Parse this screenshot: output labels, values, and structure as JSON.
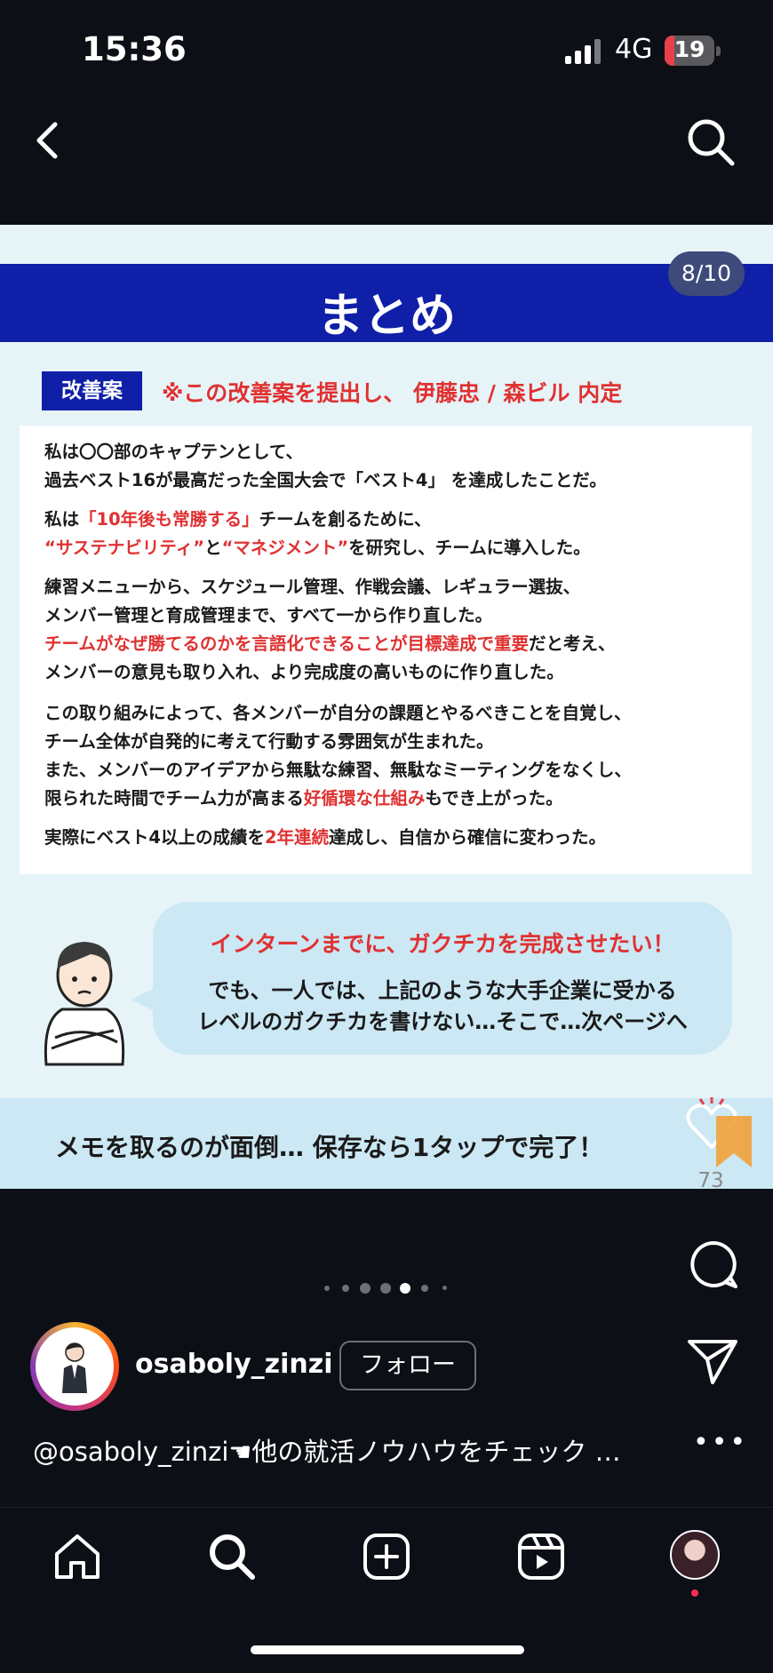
{
  "status_bar": {
    "time": "15:36",
    "network": "4G",
    "battery": "19",
    "battery_level": 0.19
  },
  "post": {
    "page_counter": "8/10",
    "banner_title": "まとめ",
    "tag_label": "改善案",
    "tag_note": "※この改善案を提出し、 伊藤忠 / 森ビル 内定",
    "card": {
      "p1_l1": "私は〇〇部のキャプテンとして、",
      "p1_l2": "過去ベスト16が最高だった全国大会で「ベスト4」 を達成したことだ。",
      "p2_l1_a": "私は",
      "p2_l1_b": "「10年後も常勝する」",
      "p2_l1_c": "チームを創るために、",
      "p2_l2_a": "“サステナビリティ”",
      "p2_l2_b": "と",
      "p2_l2_c": "“マネジメント”",
      "p2_l2_d": "を研究し、チームに導入した。",
      "p3_l1": "練習メニューから、スケジュール管理、作戦会議、レギュラー選抜、",
      "p3_l2": "メンバー管理と育成管理まで、すべて一から作り直した。",
      "p3_l3_a": "チームがなぜ勝てるのかを言語化できることが目標達成で重要",
      "p3_l3_b": "だと考え、",
      "p3_l4": "メンバーの意見も取り入れ、より完成度の高いものに作り直した。",
      "p4_l1": "この取り組みによって、各メンバーが自分の課題とやるべきことを自覚し、",
      "p4_l2": "チーム全体が自発的に考えて行動する雰囲気が生まれた。",
      "p4_l3": "また、メンバーのアイデアから無駄な練習、無駄なミーティングをなくし、",
      "p4_l4_a": "限られた時間でチーム力が高まる",
      "p4_l4_b": "好循環な仕組み",
      "p4_l4_c": "もでき上がった。",
      "p5_a": "実際にベスト4以上の成績を",
      "p5_b": "2年連続",
      "p5_c": "達成し、自信から確信に変わった。"
    },
    "bubble": {
      "red": "インターンまでに、ガクチカを完成させたい！",
      "line1": "でも、一人では、上記のような大手企業に受かる",
      "line2": "レベルのガクチカを書けない…そこで…次ページへ"
    },
    "memo": "メモを取るのが面倒… 保存なら1タップで完了！"
  },
  "actions": {
    "like_count": "73",
    "more": "•••"
  },
  "carousel": {
    "dots": 7,
    "active": 4
  },
  "author": {
    "username": "osaboly_zinzi",
    "follow_label": "フォロー"
  },
  "caption": "@osaboly_zinzi☚他の就活ノウハウをチェック …",
  "colors": {
    "banner": "#0f1fa8",
    "highlight": "#e03131",
    "bubble": "#cbe8f4"
  },
  "bottom_nav": [
    "home-icon",
    "search-icon",
    "create-icon",
    "reels-icon",
    "profile-avatar"
  ]
}
